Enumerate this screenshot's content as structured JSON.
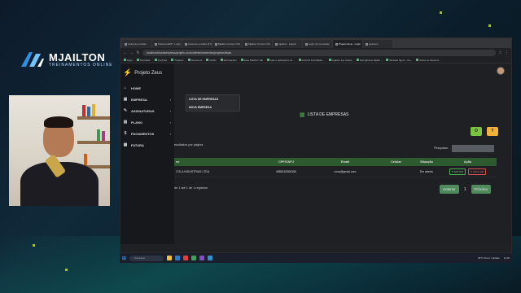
{
  "overlay": {
    "logo_text": "MJAILTON",
    "logo_sub": "TREINAMENTOS ONLINE"
  },
  "browser": {
    "tabs": [
      {
        "label": "Caixa de entrada"
      },
      {
        "label": "Sistema ERP - Login"
      },
      {
        "label": "Caixa de entrada (27)"
      },
      {
        "label": "Mjailton Cursos Onli"
      },
      {
        "label": "Mjailton Cursos Onli"
      },
      {
        "label": "mjailton - Agosto"
      },
      {
        "label": "Login de Consultas"
      },
      {
        "label": "Projeto Zeus - Login",
        "active": true
      },
      {
        "label": "quantum"
      }
    ],
    "url": "localhost/contaexpress/projeto-crud/clientes/ameniza/projetos/listar",
    "bookmarks": [
      "Apps",
      "Novidade",
      "YouTube",
      "Tradutor",
      "Document",
      "Netflix",
      "Decorações",
      "Java Platform SE",
      "Ajax e aplicações ac...",
      "Android Full Mjailto...",
      "mjailton top vídeos",
      "Springframe Mjaltu...",
      "Website figuro - tra...",
      "Todos os favoritos"
    ]
  },
  "app": {
    "brand": "Projeto Zeus",
    "menu": [
      {
        "label": "HOME",
        "icon": "home-icon",
        "glyph": "⌂",
        "chevron": false
      },
      {
        "label": "EMPRESA",
        "icon": "building-icon",
        "glyph": "▣",
        "chevron": true
      },
      {
        "label": "ASSINATURAS",
        "icon": "signature-icon",
        "glyph": "✎",
        "chevron": true
      },
      {
        "label": "PLANO",
        "icon": "plan-icon",
        "glyph": "▤",
        "chevron": true
      },
      {
        "label": "PAGAMENTOS",
        "icon": "payment-icon",
        "glyph": "$",
        "chevron": true
      },
      {
        "label": "FATURA",
        "icon": "invoice-icon",
        "glyph": "▦",
        "chevron": false
      }
    ],
    "dropdown": [
      "LISTA DE EMPRESAS",
      "NOVA EMPRESA"
    ],
    "page_title": "LISTA DE EMPRESAS",
    "per_page_text": "esultados por página",
    "search_label": "Pesquisar:",
    "search_value": "",
    "table": {
      "headers": [
        "ne",
        "CPF/CNPJ",
        "Email",
        "Celular",
        "Situação",
        "Ação"
      ],
      "rows": [
        {
          "name": "COLA INDUSTRIAS LTDA",
          "cpf": "4888161808180",
          "email": "cosa@gmail.com",
          "celular": "",
          "situacao": "Em aberto",
          "edit": "EDITAR",
          "delete": "EXCLUIR"
        }
      ]
    },
    "footer_info": "de 1 até 1 de 1 registros",
    "pager": {
      "prev": "Anterior",
      "page": "1",
      "next": "Próximo"
    },
    "green_btn": "O",
    "orange_btn": "T"
  },
  "taskbar": {
    "search_placeholder": "Pesquisar",
    "weather": "28°C Prevl. nublado",
    "time": "11:05"
  },
  "colors": {
    "accent_green": "#2d5a2e",
    "button_green": "#7cc243",
    "button_orange": "#f0b23a",
    "brand_bolt": "#f5d020"
  }
}
